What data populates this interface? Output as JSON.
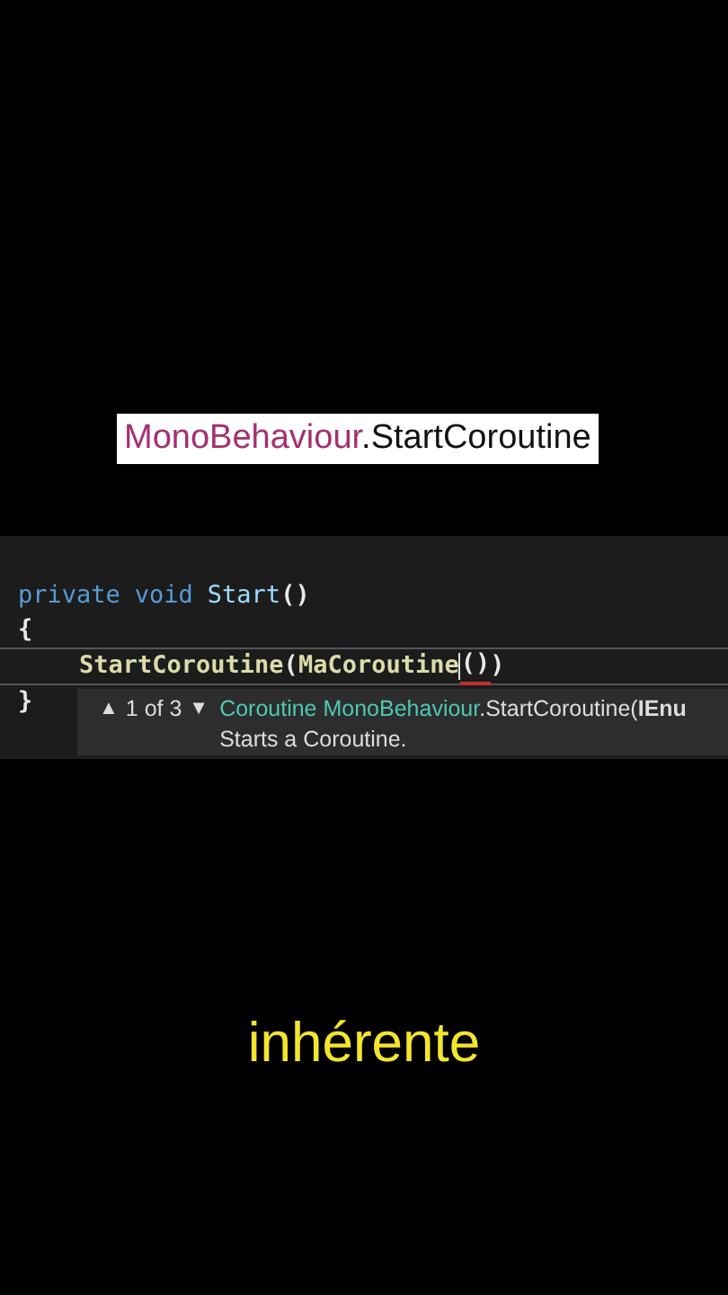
{
  "heading": {
    "class_name": "MonoBehaviour",
    "member": ".StartCoroutine"
  },
  "editor": {
    "lines": [
      {
        "current": false,
        "tokens": [
          {
            "kind": "keyword",
            "text": "private"
          },
          {
            "kind": "keyword",
            "text": "void"
          },
          {
            "kind": "name",
            "text": "Start"
          },
          {
            "kind": "punct",
            "text": "()"
          }
        ]
      },
      {
        "current": false,
        "tokens": [
          {
            "kind": "punct",
            "text": "{"
          }
        ]
      },
      {
        "current": true,
        "tokens": [
          {
            "kind": "method",
            "text": "StartCoroutine"
          },
          {
            "kind": "punct",
            "text": "("
          },
          {
            "kind": "method",
            "text": "MaCoroutine"
          },
          {
            "kind": "error",
            "text": "()"
          },
          {
            "kind": "punct",
            "text": ")"
          }
        ]
      },
      {
        "current": false,
        "tokens": [
          {
            "kind": "punct",
            "text": "}"
          }
        ]
      }
    ],
    "tooltip": {
      "up": "▲",
      "counter": "1 of 3",
      "down": "▼",
      "signature_type": "Coroutine MonoBehaviour",
      "signature_rest": ".StartCoroutine(",
      "signature_param": "IEnu",
      "description": "Starts a Coroutine."
    }
  },
  "caption": "inhérente"
}
